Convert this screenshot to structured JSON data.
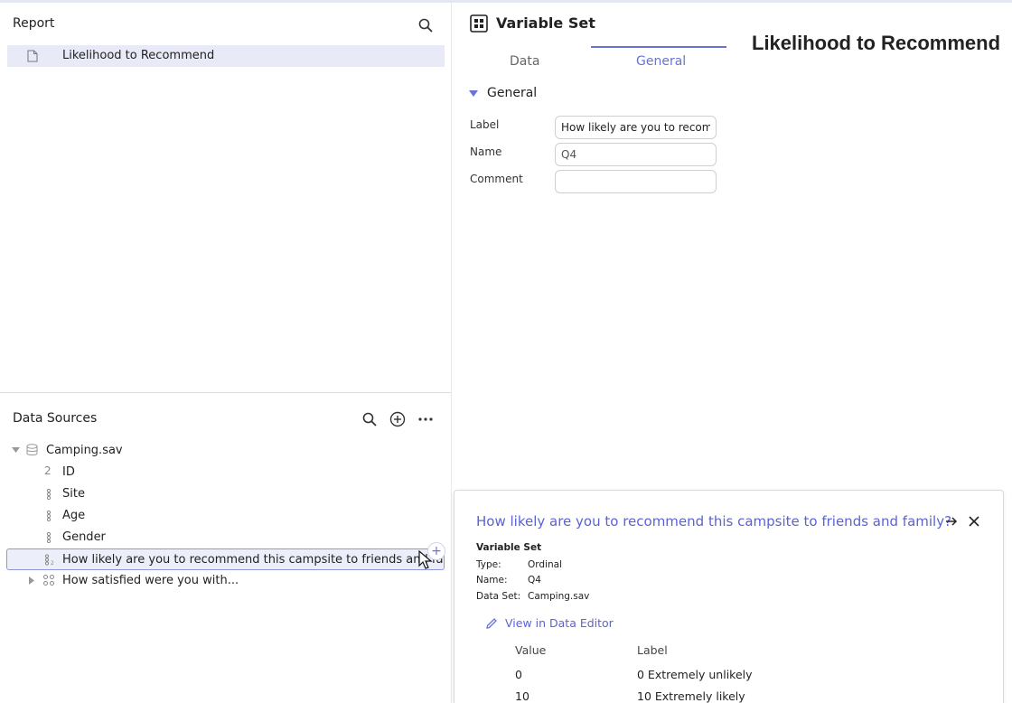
{
  "report": {
    "title": "Report",
    "items": [
      {
        "label": "Likelihood to Recommend"
      }
    ]
  },
  "data_sources": {
    "title": "Data Sources",
    "file": "Camping.sav",
    "variables": [
      {
        "label": "ID",
        "type_glyph": "2"
      },
      {
        "label": "Site"
      },
      {
        "label": "Age"
      },
      {
        "label": "Gender"
      },
      {
        "label": "How likely are you to recommend this campsite to friends and family?"
      },
      {
        "label": "How satisfied were you with..."
      }
    ],
    "add_badge": "+"
  },
  "variable_set": {
    "title": "Variable Set",
    "tabs": [
      {
        "label": "Data"
      },
      {
        "label": "General"
      }
    ],
    "active_tab": "General",
    "section": "General",
    "fields": {
      "label_caption": "Label",
      "label_value": "How likely are you to recom...",
      "name_caption": "Name",
      "name_value": "Q4",
      "comment_caption": "Comment",
      "comment_value": ""
    }
  },
  "page_heading": "Likelihood to Recommend",
  "popup": {
    "title": "How likely are you to recommend this campsite to friends and family?",
    "subtitle": "Variable Set",
    "meta": [
      {
        "key": "Type:",
        "value": "Ordinal"
      },
      {
        "key": "Name:",
        "value": "Q4"
      },
      {
        "key": "Data Set:",
        "value": "Camping.sav"
      }
    ],
    "edit_link": "View in Data Editor",
    "table_headers": [
      "Value",
      "Label"
    ],
    "rows": [
      {
        "value": "0",
        "label": "0 Extremely unlikely"
      },
      {
        "value": "10",
        "label": "10 Extremely likely"
      }
    ]
  },
  "colors": {
    "accent": "#6a72d9",
    "selection": "#e8eaf8",
    "link": "#5b63d3"
  },
  "icons": [
    "search-icon",
    "document-icon",
    "add-circle-icon",
    "more-icon",
    "database-icon",
    "grid-icon",
    "arrow-right-icon",
    "close-icon",
    "pencil-icon",
    "cursor-icon"
  ]
}
